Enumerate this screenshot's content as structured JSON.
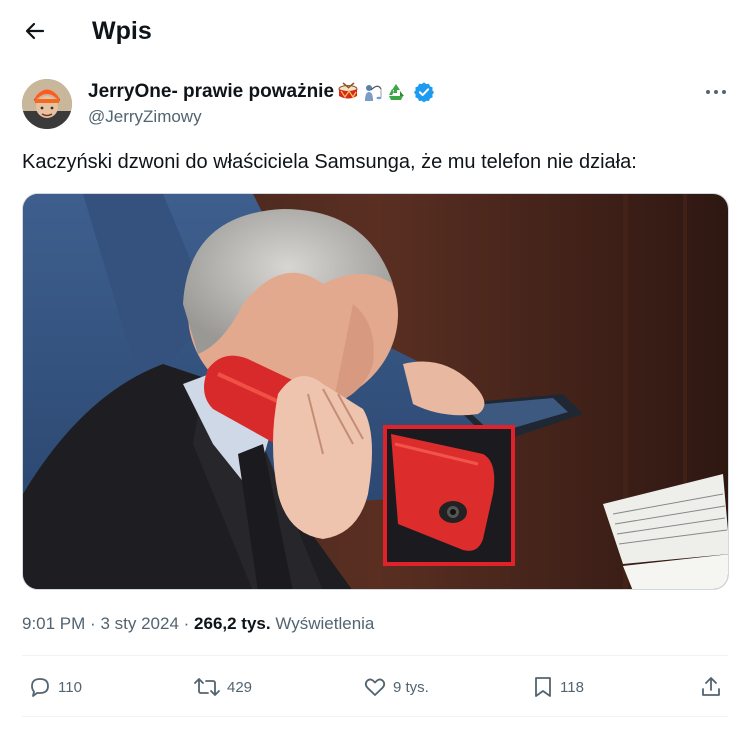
{
  "header": {
    "title": "Wpis",
    "back_icon": "arrow-left-icon"
  },
  "author": {
    "display_name": "JerryOne- prawie poważnie",
    "emojis": [
      "drum-emoji",
      "person-fishing-emoji",
      "recycle-emoji"
    ],
    "verified": true,
    "handle": "@JerryZimowy"
  },
  "post": {
    "text": "Kaczyński dzwoni do właściciela Samsunga, że mu telefon nie działa:"
  },
  "meta": {
    "time": "9:01 PM",
    "sep1": "·",
    "date": "3 sty 2024",
    "sep2": "·",
    "views_count": "266,2 tys.",
    "views_label": "Wyświetlenia"
  },
  "actions": {
    "replies": "110",
    "reposts": "429",
    "likes": "9 tys.",
    "bookmarks": "118"
  },
  "colors": {
    "text": "#0f1419",
    "secondary": "#536471",
    "verified": "#1d9bf0",
    "divider": "#eff3f4",
    "highlight": "#e0222b"
  }
}
